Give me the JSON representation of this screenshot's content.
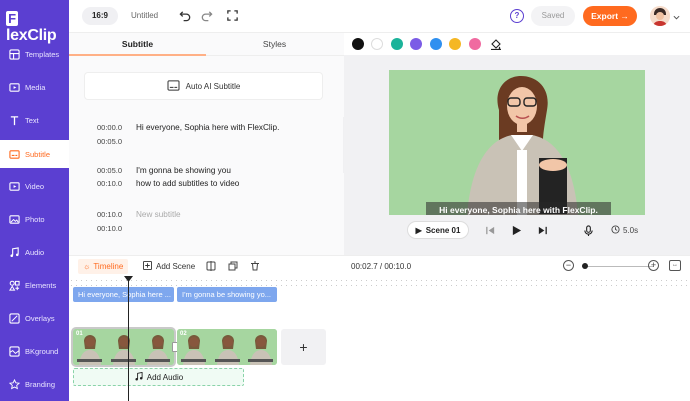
{
  "app": {
    "logo": "FlexClip",
    "ratio": "16:9",
    "doc_title": "Untitled"
  },
  "header": {
    "help": "?",
    "saved": "Saved",
    "export": "Export →"
  },
  "sidebar": {
    "items": [
      {
        "label": "Templates"
      },
      {
        "label": "Media"
      },
      {
        "label": "Text"
      },
      {
        "label": "Subtitle"
      },
      {
        "label": "Video"
      },
      {
        "label": "Photo"
      },
      {
        "label": "Audio"
      },
      {
        "label": "Elements"
      },
      {
        "label": "Overlays"
      },
      {
        "label": "BKground"
      },
      {
        "label": "Branding"
      }
    ]
  },
  "panel": {
    "tabs": [
      {
        "label": "Subtitle"
      },
      {
        "label": "Styles"
      }
    ],
    "ai_button": "Auto AI Subtitle",
    "subtitles": [
      {
        "start": "00:00.0",
        "end": "00:05.0",
        "text": "Hi everyone, Sophia here with FlexClip.",
        "placeholder": false
      },
      {
        "start": "00:05.0",
        "end": "00:10.0",
        "text": "I'm gonna be showing you\nhow to add subtitles to video",
        "placeholder": false
      },
      {
        "start": "00:10.0",
        "end": "00:10.0",
        "text": "New subtitle",
        "placeholder": true
      }
    ]
  },
  "colors": {
    "swatches": [
      "#111111",
      "#ffffff",
      "#1bb39a",
      "#7b5ce6",
      "#2f90f0",
      "#f5b724",
      "#f06aa0"
    ],
    "accent": "#ff6a1f",
    "brand": "#5b3fd1"
  },
  "preview": {
    "caption": "Hi everyone, Sophia here with FlexClip.",
    "scene_label": "Scene 01",
    "duration": "5.0s"
  },
  "timeline": {
    "tab": "Timeline",
    "add_scene": "Add Scene",
    "time": "00:02.7 / 00:10.0",
    "subtitle_chips": [
      {
        "text": "Hi everyone, Sophia here ..."
      },
      {
        "text": "I'm gonna be showing yo..."
      }
    ],
    "clips": [
      {
        "num": "01"
      },
      {
        "num": "02"
      }
    ],
    "add_audio": "Add Audio"
  }
}
